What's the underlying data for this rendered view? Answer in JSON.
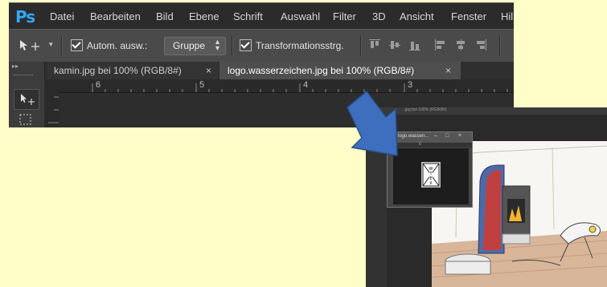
{
  "app": {
    "logo": "Ps"
  },
  "menu": [
    "Datei",
    "Bearbeiten",
    "Bild",
    "Ebene",
    "Schrift",
    "Auswahl",
    "Filter",
    "3D",
    "Ansicht",
    "Fenster",
    "Hil"
  ],
  "options": {
    "auto_select_label": "Autom. ausw.:",
    "auto_select_value": "Gruppe",
    "transform_label": "Transformationsstrg."
  },
  "tabs": [
    {
      "label": "kamin.jpg bei 100% (RGB/8#)",
      "close": "×"
    },
    {
      "label": "logo.wasserzeichen.jpg bei 100% (RGB/8#)",
      "close": "×"
    }
  ],
  "ruler": {
    "marks": [
      "6",
      "5",
      "4",
      "3"
    ]
  },
  "overlay": {
    "tab_caption": "...jpg bei 100% (RGB/8#)",
    "window_title": "logo.wassen...",
    "window_buttons": [
      "–",
      "□",
      "×"
    ],
    "ruler_mark": "6",
    "logo_letters": "WTEX"
  },
  "colors": {
    "arrow": "#3d6fbe",
    "ps_blue": "#31a8ff",
    "background": "#fffdc8"
  }
}
